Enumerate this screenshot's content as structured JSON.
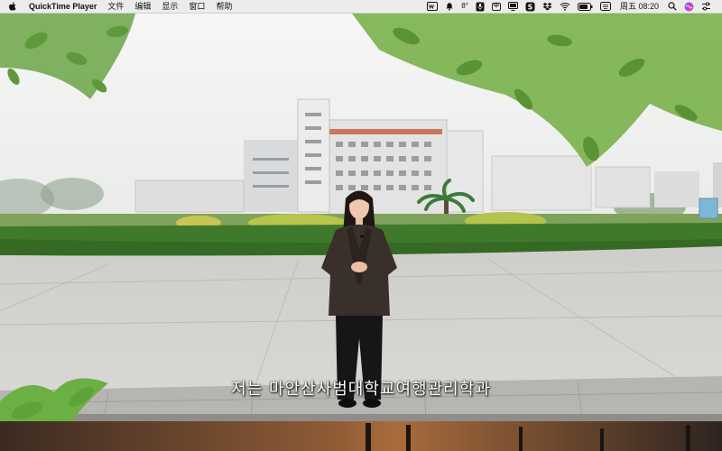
{
  "menubar": {
    "app_name": "QuickTime Player",
    "menus": [
      "文件",
      "编辑",
      "显示",
      "窗口",
      "帮助"
    ],
    "status": {
      "input_badge": "中",
      "temperature": "8°",
      "datetime": "周五 08:20"
    },
    "icons": [
      "apple-logo-icon",
      "wechat-icon",
      "bell-icon",
      "mic-icon",
      "input-method-icon",
      "display-icon",
      "skype-icon",
      "dropbox-icon",
      "wifi-icon",
      "battery-icon",
      "keyboard-icon",
      "search-icon",
      "siri-icon",
      "control-center-icon"
    ]
  },
  "video": {
    "subtitle": "저는 마안산사범대학교여행관리학과",
    "colors": {
      "sky": "#f1f2f1",
      "hedge": "#3f7a2c",
      "pavement": "#d7d6d3",
      "jacket": "#3a302b"
    }
  }
}
